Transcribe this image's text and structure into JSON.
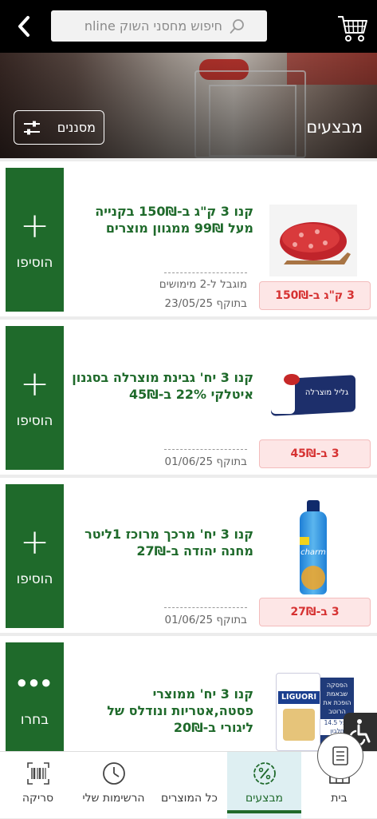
{
  "header": {
    "search_placeholder": "חיפוש מחסני השוק nline",
    "back_icon": "chevron-left-icon",
    "cart_icon": "cart-icon",
    "search_icon": "search-icon"
  },
  "banner": {
    "title": "מבצעים",
    "filter_label": "מסננים",
    "filter_icon": "sliders-icon"
  },
  "deals": [
    {
      "title": "קנו 3 ק\"ג ב-150₪ בקנייה מעל 99₪ ממגוון מוצרים",
      "limit": "מוגבל ל-2 מימושים",
      "valid": "בתוקף 23/05/25",
      "badge": "3 ק\"ג ב-150₪",
      "action_label": "הוסיפו",
      "action_icon": "plus-icon",
      "image": "ground-meat-image"
    },
    {
      "title": "קנו 3 יח' גבינת מוצרלה בסגנון איטלקי 22% ב-45₪",
      "valid": "בתוקף 01/06/25",
      "badge": "3 ב-45₪",
      "action_label": "הוסיפו",
      "action_icon": "plus-icon",
      "image": "mozzarella-image",
      "package_text": "גליל מוצרלה"
    },
    {
      "title": "קנו 3 יח' מרכך מרוכז 1ליטר מחנה יהודה ב-27₪",
      "valid": "בתוקף 01/06/25",
      "badge": "3 ב-27₪",
      "action_label": "הוסיפו",
      "action_icon": "plus-icon",
      "image": "softener-bottle-image",
      "package_text": "charm"
    },
    {
      "title": "קנו 3 יח' ממוצרי פסטה,אטריות ונודלס של ליגורי ב-20₪",
      "action_label": "בחרו",
      "action_icon": "ellipsis-icon",
      "image": "pasta-image",
      "package_text": "LIGUORI",
      "notice": "הפסקה שבאמת הופכת את הרוטב",
      "notice_small": "מבל 14.5 חלבון"
    }
  ],
  "bottom_nav": [
    {
      "label": "בית",
      "icon": "home-icon"
    },
    {
      "label": "מבצעים",
      "icon": "percent-badge-icon",
      "active": true
    },
    {
      "label": "כל המוצרים",
      "icon": "list-icon"
    },
    {
      "label": "הרשימות שלי",
      "icon": "clock-icon"
    },
    {
      "label": "סריקה",
      "icon": "barcode-scan-icon"
    }
  ],
  "accessibility_icon": "wheelchair-icon",
  "colors": {
    "brand_green": "#1f6a2b",
    "badge_bg": "#fde6e6",
    "badge_text": "#d63232",
    "active_nav_bg": "#deeff2"
  }
}
